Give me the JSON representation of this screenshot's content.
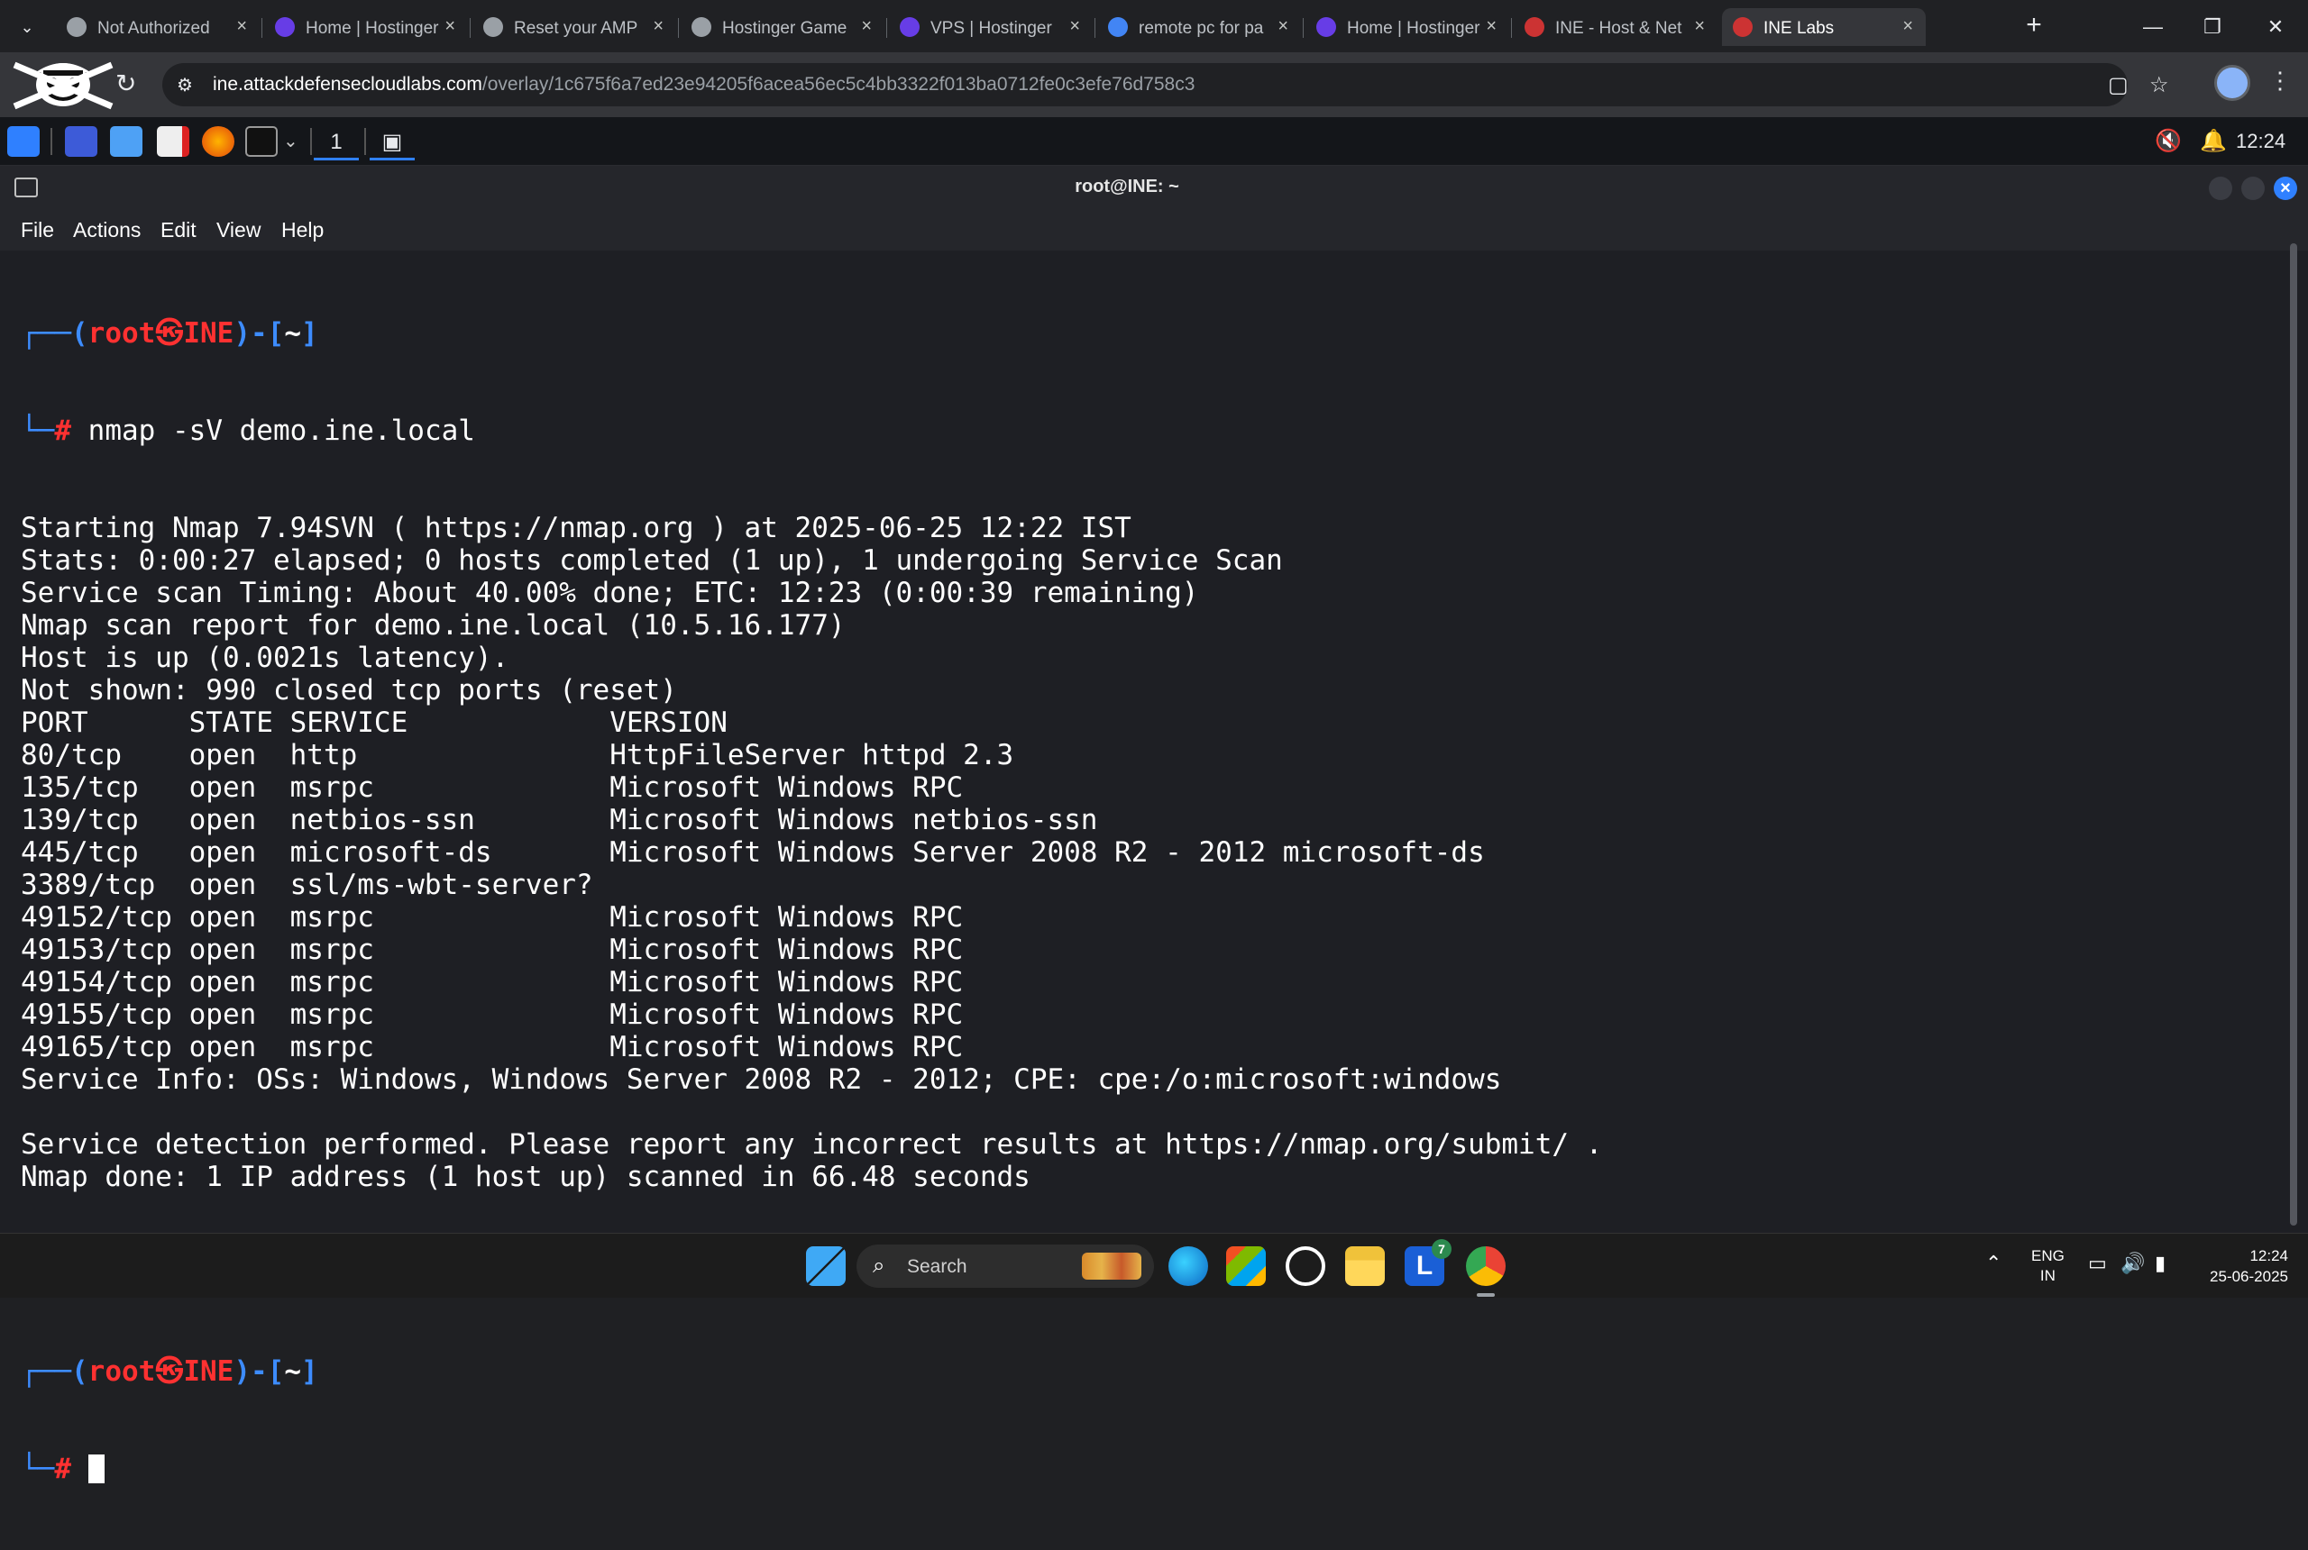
{
  "browser": {
    "tabs": [
      {
        "label": "Not Authorized",
        "favicon": "globe-icon",
        "color": "#9aa0a6"
      },
      {
        "label": "Home | Hostinger",
        "favicon": "hostinger-icon",
        "color": "#673de6"
      },
      {
        "label": "Reset your AMP",
        "favicon": "google-icon",
        "color": "#9aa0a6"
      },
      {
        "label": "Hostinger Game",
        "favicon": "google-icon",
        "color": "#9aa0a6"
      },
      {
        "label": "VPS | Hostinger",
        "favicon": "hostinger-icon",
        "color": "#673de6"
      },
      {
        "label": "remote pc for pa",
        "favicon": "google-icon",
        "color": "#4285f4"
      },
      {
        "label": "Home | Hostinger",
        "favicon": "hostinger-icon",
        "color": "#673de6"
      },
      {
        "label": "INE - Host & Net",
        "favicon": "ine-icon",
        "color": "#cc3333"
      },
      {
        "label": "INE Labs",
        "favicon": "ine-icon",
        "color": "#cc3333"
      }
    ],
    "active_tab": 8,
    "new_tab": "+",
    "url_host": "ine.attackdefensecloudlabs.com",
    "url_path": "/overlay/1c675f6a7ed23e94205f6acea56ec5c4bb3322f013ba0712fe0c3efe76d758c3"
  },
  "panel": {
    "workspace": "1",
    "clock": "12:24"
  },
  "terminal": {
    "title": "root@INE: ~",
    "menu": [
      "File",
      "Actions",
      "Edit",
      "View",
      "Help"
    ],
    "prompt": {
      "user": "root",
      "skull": "㉿",
      "host": "INE",
      "dir": "~",
      "hash": "#"
    },
    "command": "nmap -sV demo.ine.local",
    "output": [
      "Starting Nmap 7.94SVN ( https://nmap.org ) at 2025-06-25 12:22 IST",
      "Stats: 0:00:27 elapsed; 0 hosts completed (1 up), 1 undergoing Service Scan",
      "Service scan Timing: About 40.00% done; ETC: 12:23 (0:00:39 remaining)",
      "Nmap scan report for demo.ine.local (10.5.16.177)",
      "Host is up (0.0021s latency).",
      "Not shown: 990 closed tcp ports (reset)",
      "PORT      STATE SERVICE            VERSION",
      "80/tcp    open  http               HttpFileServer httpd 2.3",
      "135/tcp   open  msrpc              Microsoft Windows RPC",
      "139/tcp   open  netbios-ssn        Microsoft Windows netbios-ssn",
      "445/tcp   open  microsoft-ds       Microsoft Windows Server 2008 R2 - 2012 microsoft-ds",
      "3389/tcp  open  ssl/ms-wbt-server?",
      "49152/tcp open  msrpc              Microsoft Windows RPC",
      "49153/tcp open  msrpc              Microsoft Windows RPC",
      "49154/tcp open  msrpc              Microsoft Windows RPC",
      "49155/tcp open  msrpc              Microsoft Windows RPC",
      "49165/tcp open  msrpc              Microsoft Windows RPC",
      "Service Info: OSs: Windows, Windows Server 2008 R2 - 2012; CPE: cpe:/o:microsoft:windows",
      "",
      "Service detection performed. Please report any incorrect results at https://nmap.org/submit/ .",
      "Nmap done: 1 IP address (1 host up) scanned in 66.48 seconds"
    ]
  },
  "taskbar": {
    "search_label": "Search",
    "lang_top": "ENG",
    "lang_bottom": "IN",
    "time": "12:24",
    "date": "25-06-2025",
    "notification_badge": "7"
  },
  "colors": {
    "prompt_blue": "#3d8cff",
    "prompt_red": "#ff3131",
    "accent": "#2f80ff"
  }
}
